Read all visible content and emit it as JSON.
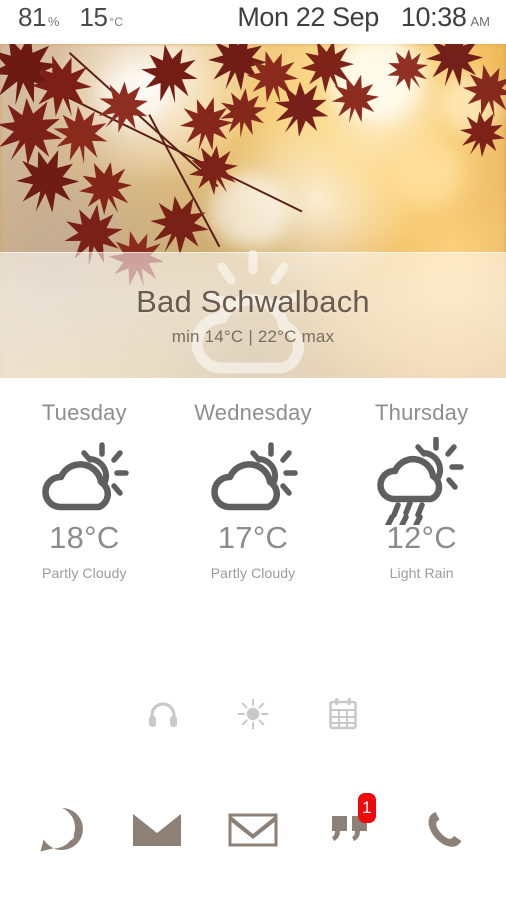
{
  "statusbar": {
    "battery_value": "81",
    "battery_unit": "%",
    "temperature_value": "15",
    "temperature_unit": "°C",
    "date": "Mon 22 Sep",
    "time": "10:38",
    "ampm": "AM"
  },
  "current_weather": {
    "city": "Bad Schwalbach",
    "min_max": "min 14°C | 22°C max",
    "icon": "partly-cloudy-icon"
  },
  "forecast": [
    {
      "day": "Tuesday",
      "temp": "18°C",
      "desc": "Partly Cloudy",
      "icon": "partly-cloudy-icon"
    },
    {
      "day": "Wednesday",
      "temp": "17°C",
      "desc": "Partly Cloudy",
      "icon": "partly-cloudy-icon"
    },
    {
      "day": "Thursday",
      "temp": "12°C",
      "desc": "Light Rain",
      "icon": "rain-icon"
    }
  ],
  "shortcuts": [
    {
      "name": "headphones-icon",
      "label": "Headphones"
    },
    {
      "name": "brightness-sun-icon",
      "label": "Brightness"
    },
    {
      "name": "calendar-icon",
      "label": "Calendar"
    }
  ],
  "dock": [
    {
      "name": "whatsapp-icon",
      "label": "WhatsApp",
      "badge": ""
    },
    {
      "name": "mail-envelope-icon",
      "label": "Mail",
      "badge": ""
    },
    {
      "name": "gmail-icon",
      "label": "Gmail",
      "badge": ""
    },
    {
      "name": "sms-quote-icon",
      "label": "Messages",
      "badge": "1"
    },
    {
      "name": "phone-handset-icon",
      "label": "Phone",
      "badge": ""
    }
  ],
  "colors": {
    "status_text": "#4a4a4a",
    "forecast_text": "#8e8e8e",
    "city_text": "#6a5a50",
    "dock_icon": "#8d8177",
    "badge_background": "#ee0a0a",
    "badge_text": "#ffffff",
    "shortcut_icon": "#c9c9c9",
    "card_background": "#ffffff"
  }
}
